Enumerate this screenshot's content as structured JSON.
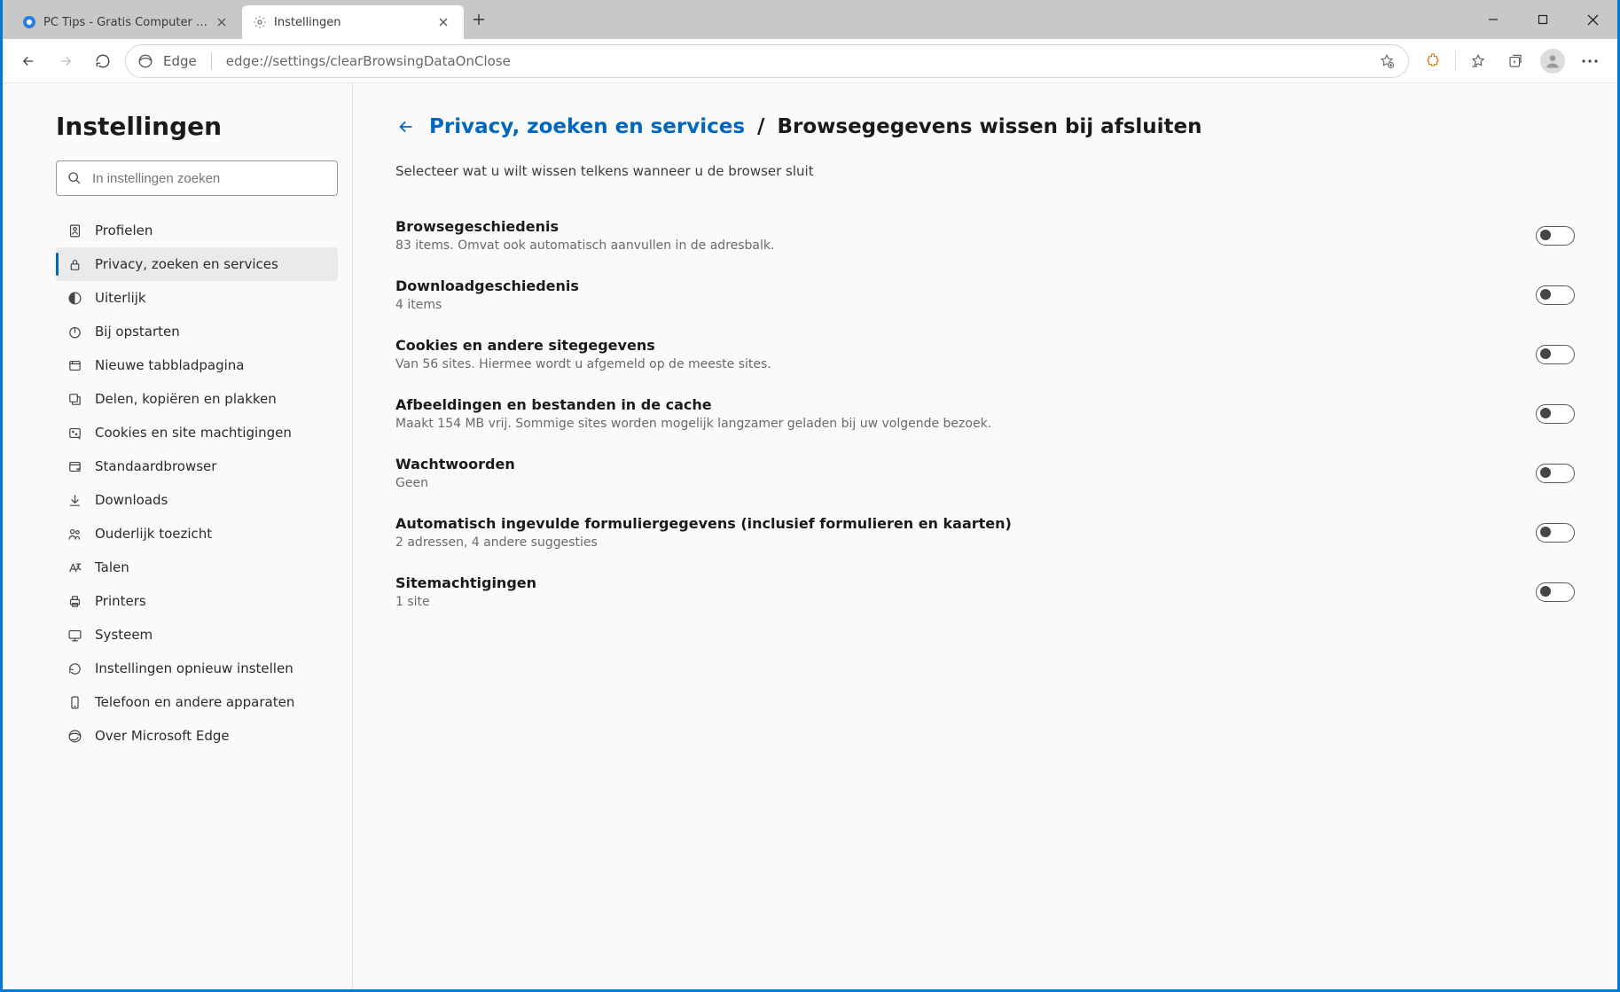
{
  "tabs": [
    {
      "title": "PC Tips - Gratis Computer Tips, i…",
      "favicon": "circle-blue"
    },
    {
      "title": "Instellingen",
      "favicon": "gear"
    }
  ],
  "address": {
    "label": "Edge",
    "url": "edge://settings/clearBrowsingDataOnClose"
  },
  "sidebar": {
    "title": "Instellingen",
    "search_placeholder": "In instellingen zoeken",
    "items": [
      {
        "label": "Profielen",
        "icon": "profile"
      },
      {
        "label": "Privacy, zoeken en services",
        "icon": "lock",
        "active": true
      },
      {
        "label": "Uiterlijk",
        "icon": "appearance"
      },
      {
        "label": "Bij opstarten",
        "icon": "power"
      },
      {
        "label": "Nieuwe tabbladpagina",
        "icon": "newtab"
      },
      {
        "label": "Delen, kopiëren en plakken",
        "icon": "share"
      },
      {
        "label": "Cookies en site machtigingen",
        "icon": "cookies"
      },
      {
        "label": "Standaardbrowser",
        "icon": "default"
      },
      {
        "label": "Downloads",
        "icon": "download"
      },
      {
        "label": "Ouderlijk toezicht",
        "icon": "family"
      },
      {
        "label": "Talen",
        "icon": "lang"
      },
      {
        "label": "Printers",
        "icon": "printer"
      },
      {
        "label": "Systeem",
        "icon": "system"
      },
      {
        "label": "Instellingen opnieuw instellen",
        "icon": "reset"
      },
      {
        "label": "Telefoon en andere apparaten",
        "icon": "phone"
      },
      {
        "label": "Over Microsoft Edge",
        "icon": "edge"
      }
    ]
  },
  "main": {
    "breadcrumb_link": "Privacy, zoeken en services",
    "breadcrumb_sep": "/",
    "breadcrumb_current": "Browsegegevens wissen bij afsluiten",
    "subtitle": "Selecteer wat u wilt wissen telkens wanneer u de browser sluit",
    "settings": [
      {
        "title": "Browsegeschiedenis",
        "desc": "83 items. Omvat ook automatisch aanvullen in de adresbalk.",
        "on": false
      },
      {
        "title": "Downloadgeschiedenis",
        "desc": "4 items",
        "on": false
      },
      {
        "title": "Cookies en andere sitegegevens",
        "desc": "Van 56 sites. Hiermee wordt u afgemeld op de meeste sites.",
        "on": false
      },
      {
        "title": "Afbeeldingen en bestanden in de cache",
        "desc": "Maakt 154 MB vrij. Sommige sites worden mogelijk langzamer geladen bij uw volgende bezoek.",
        "on": false
      },
      {
        "title": "Wachtwoorden",
        "desc": "Geen",
        "on": false
      },
      {
        "title": "Automatisch ingevulde formuliergegevens (inclusief formulieren en kaarten)",
        "desc": "2 adressen, 4 andere suggesties",
        "on": false
      },
      {
        "title": "Sitemachtigingen",
        "desc": "1 site",
        "on": false
      }
    ]
  }
}
